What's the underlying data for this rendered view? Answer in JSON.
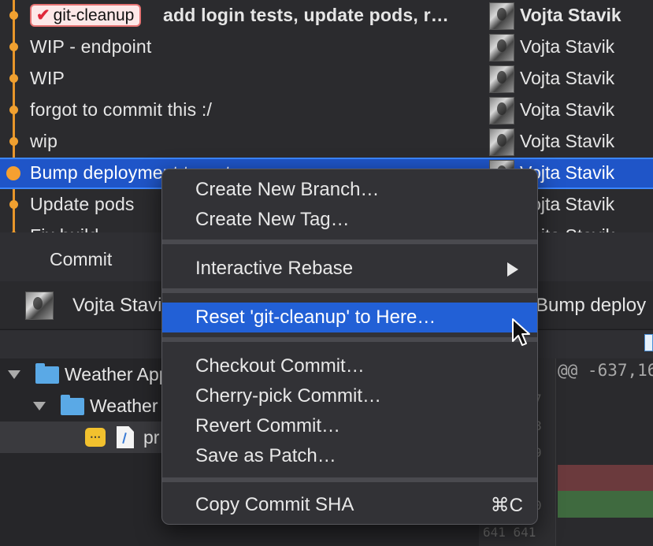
{
  "commits": [
    {
      "branch_tag": "git-cleanup",
      "message": "add login tests, update pods, r…",
      "author": "Vojta Stavik"
    },
    {
      "message": "WIP - endpoint",
      "author": "Vojta Stavik"
    },
    {
      "message": "WIP",
      "author": "Vojta Stavik"
    },
    {
      "message": "forgot to commit this :/",
      "author": "Vojta Stavik"
    },
    {
      "message": "wip",
      "author": "Vojta Stavik"
    },
    {
      "message": "Bump deployment target",
      "author": "Vojta Stavik"
    },
    {
      "message": "Update pods",
      "author": "Vojta Stavik"
    },
    {
      "message": "Fix build",
      "author": "Vojta Stavik"
    }
  ],
  "commit_panel": {
    "title": "Commit",
    "author": "Vojta Stavik",
    "message": "Bump deploy"
  },
  "file_tree": [
    {
      "label": "Weather App",
      "type": "folder"
    },
    {
      "label": "Weather",
      "type": "folder"
    },
    {
      "label": "pr",
      "type": "file",
      "badge": "⋯"
    }
  ],
  "diff": {
    "hunk_header": "@@ -637,16",
    "line_numbers": [
      "7",
      "8",
      "9",
      "0",
      "641   641"
    ]
  },
  "context_menu": {
    "groups": [
      [
        "Create New Branch…",
        "Create New Tag…"
      ],
      [
        "Interactive Rebase"
      ],
      [
        "Reset 'git-cleanup' to Here…"
      ],
      [
        "Checkout Commit…",
        "Cherry-pick Commit…",
        "Revert Commit…",
        "Save as Patch…"
      ],
      [
        "Copy Commit SHA"
      ]
    ],
    "shortcut_copy_sha": "⌘C",
    "highlighted": "Reset 'git-cleanup' to Here…"
  },
  "colors": {
    "accent": "#2260d6",
    "graph": "#e8962a",
    "diff_removed": "#6b3a3d",
    "diff_added": "#3f6a3f"
  }
}
